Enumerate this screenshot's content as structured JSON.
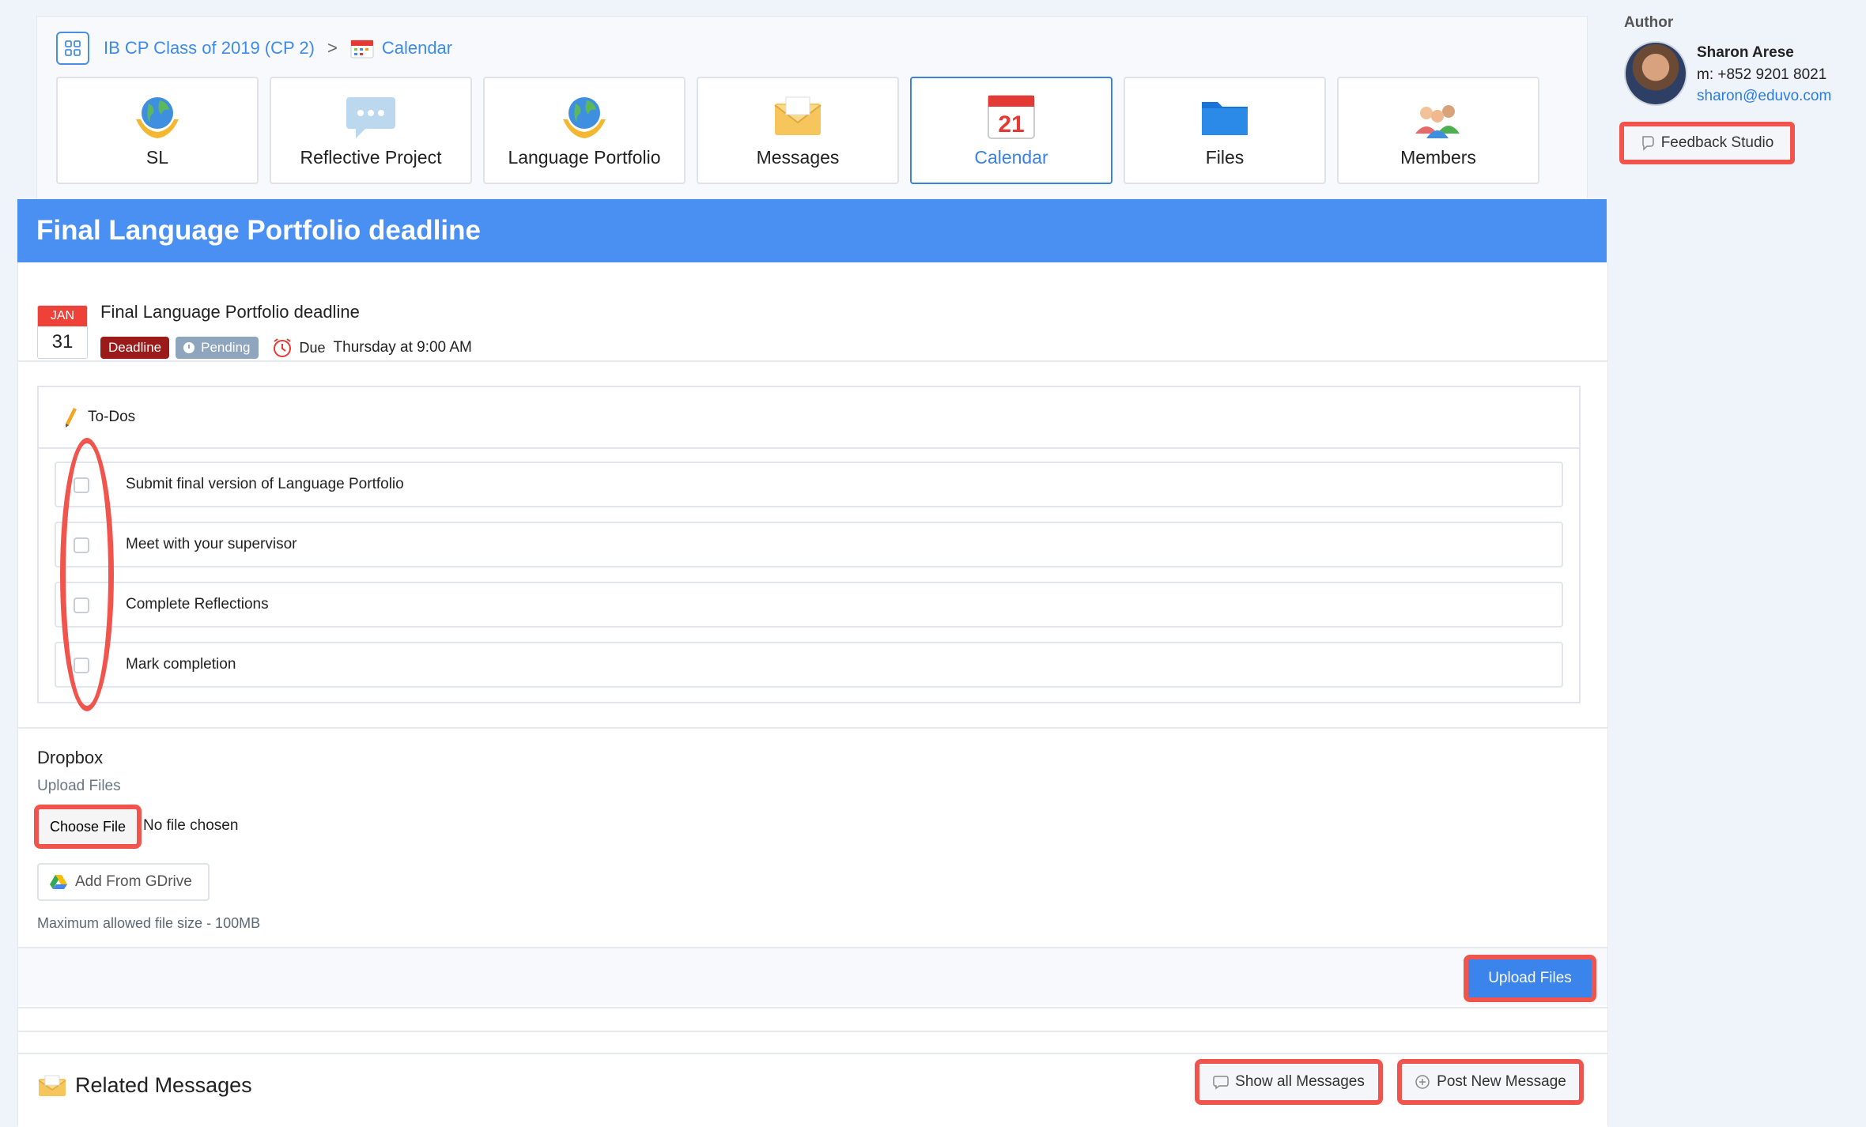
{
  "breadcrumb": {
    "course": "IB CP Class of 2019 (CP 2)",
    "separator": ">",
    "current": "Calendar"
  },
  "tiles": [
    {
      "label": "SL",
      "icon": "globe-hands-icon"
    },
    {
      "label": "Reflective Project",
      "icon": "speech-bubble-icon"
    },
    {
      "label": "Language Portfolio",
      "icon": "globe-hands-icon"
    },
    {
      "label": "Messages",
      "icon": "envelope-icon"
    },
    {
      "label": "Calendar",
      "icon": "calendar-icon",
      "active": true,
      "date": "21"
    },
    {
      "label": "Files",
      "icon": "folder-icon"
    },
    {
      "label": "Members",
      "icon": "people-icon"
    }
  ],
  "author": {
    "heading": "Author",
    "name": "Sharon Arese",
    "phone": "m: +852 9201 8021",
    "email": "sharon@eduvo.com",
    "feedback_label": "Feedback Studio"
  },
  "event": {
    "page_title": "Final Language Portfolio deadline",
    "title": "Final Language Portfolio deadline",
    "month": "JAN",
    "day": "31",
    "type_badge": "Deadline",
    "status_badge": "Pending",
    "due_label": "Due",
    "due_value": "Thursday at 9:00 AM"
  },
  "todos": {
    "heading": "To-Dos",
    "items": [
      {
        "label": "Submit final version of Language Portfolio",
        "checked": false
      },
      {
        "label": "Meet with your supervisor",
        "checked": false
      },
      {
        "label": "Complete Reflections",
        "checked": false
      },
      {
        "label": "Mark completion",
        "checked": false
      }
    ]
  },
  "dropbox": {
    "title": "Dropbox",
    "upload_label": "Upload Files",
    "choose_file": "Choose File",
    "no_file": "No file chosen",
    "gdrive_label": "Add From GDrive",
    "max_size": "Maximum allowed file size - 100MB",
    "upload_button": "Upload Files"
  },
  "related": {
    "title": "Related Messages",
    "show_all": "Show all Messages",
    "post_new": "Post New Message"
  },
  "colors": {
    "accent": "#4a8ff2",
    "highlight": "#f0544c",
    "deadline": "#9b1b1b",
    "pending": "#8fa5bd"
  }
}
